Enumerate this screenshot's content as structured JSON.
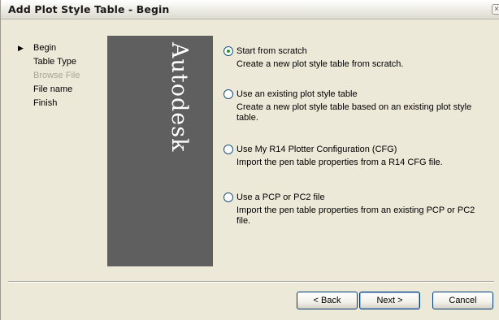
{
  "window": {
    "title": "Add Plot Style Table - Begin",
    "close_glyph": "×"
  },
  "steps": [
    {
      "label": "Begin",
      "current": true,
      "enabled": true
    },
    {
      "label": "Table Type",
      "current": false,
      "enabled": true
    },
    {
      "label": "Browse File",
      "current": false,
      "enabled": false
    },
    {
      "label": "File name",
      "current": false,
      "enabled": true
    },
    {
      "label": "Finish",
      "current": false,
      "enabled": true
    }
  ],
  "banner": {
    "brand": "Autodesk",
    "background": "#5f5f5f"
  },
  "options": [
    {
      "label": "Start from scratch",
      "description": "Create a new plot style table from scratch.",
      "selected": true
    },
    {
      "label": "Use an existing plot style table",
      "description": "Create a new plot style table based on an existing plot style table.",
      "selected": false
    },
    {
      "label": "Use My R14 Plotter Configuration (CFG)",
      "description": "Import the pen table properties from a R14 CFG file.",
      "selected": false
    },
    {
      "label": "Use a PCP or PC2 file",
      "description": "Import the pen table properties from an existing PCP or PC2 file.",
      "selected": false
    }
  ],
  "buttons": {
    "back": "< Back",
    "next": "Next >",
    "cancel": "Cancel"
  },
  "colors": {
    "dialog_bg": "#ece9d8",
    "radio_dot": "#21a121",
    "button_border": "#003c74"
  }
}
